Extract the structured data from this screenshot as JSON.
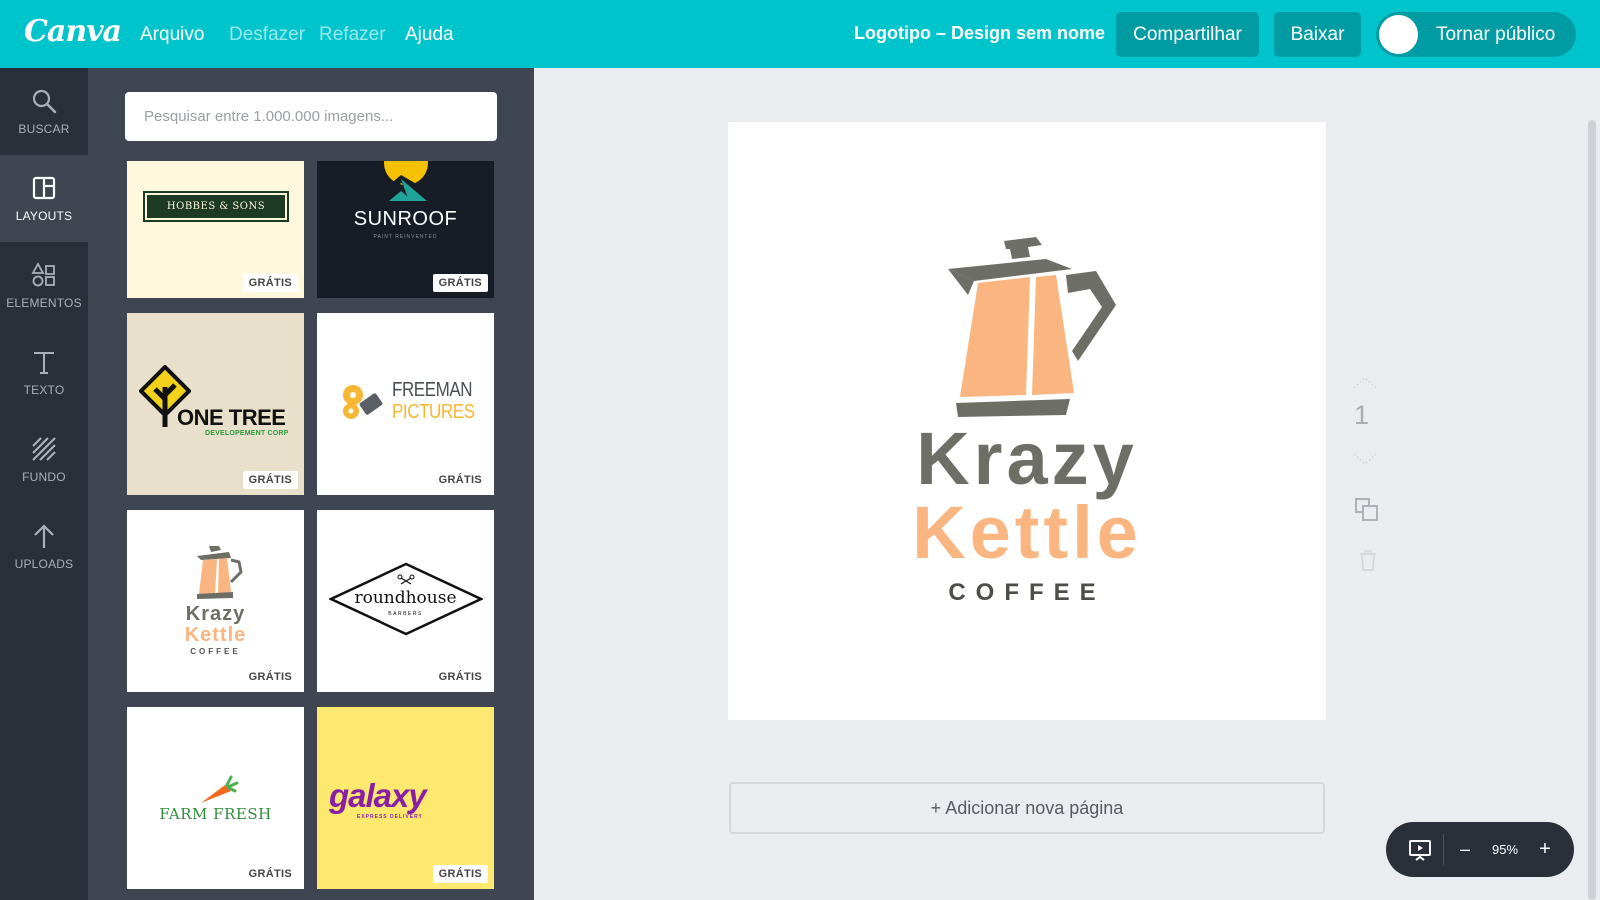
{
  "app": {
    "logo": "Canva"
  },
  "menu": {
    "file": "Arquivo",
    "undo": "Desfazer",
    "redo": "Refazer",
    "help": "Ajuda"
  },
  "header": {
    "doc_title": "Logotipo – Design sem nome",
    "share": "Compartilhar",
    "download": "Baixar",
    "public_toggle": "Tornar público"
  },
  "sidebar": {
    "items": [
      {
        "label": "BUSCAR",
        "icon": "search-icon"
      },
      {
        "label": "LAYOUTS",
        "icon": "layouts-icon",
        "active": true
      },
      {
        "label": "ELEMENTOS",
        "icon": "elements-icon"
      },
      {
        "label": "TEXTO",
        "icon": "text-icon"
      },
      {
        "label": "FUNDO",
        "icon": "background-icon"
      },
      {
        "label": "UPLOADS",
        "icon": "upload-icon"
      }
    ]
  },
  "panel": {
    "search_placeholder": "Pesquisar entre 1.000.000 imagens...",
    "templates": [
      {
        "name": "HOBBES & SONS",
        "badge": "GRÁTIS"
      },
      {
        "name": "SUNROOF",
        "sub": "PAINT REINVENTED",
        "badge": "GRÁTIS"
      },
      {
        "name": "ONE TREE",
        "sub": "DEVELOPEMENT CORP",
        "badge": "GRÁTIS"
      },
      {
        "name1": "FREEMAN",
        "name2": "PICTURES",
        "badge": "GRÁTIS"
      },
      {
        "name1": "Krazy",
        "name2": "Kettle",
        "sub": "COFFEE",
        "badge": "GRÁTIS"
      },
      {
        "name": "roundhouse",
        "sub": "BARBERS",
        "badge": "GRÁTIS"
      },
      {
        "name": "FARM FRESH",
        "badge": "GRÁTIS"
      },
      {
        "name": "galaxy",
        "sub": "EXPRESS DELIVERY",
        "badge": "GRÁTIS"
      }
    ]
  },
  "canvas": {
    "logo_line1": "Krazy",
    "logo_line2": "Kettle",
    "logo_line3": "COFFEE",
    "page_number": "1",
    "add_page": "+ Adicionar nova página",
    "zoom": "95%",
    "zoom_minus": "–",
    "zoom_plus": "+"
  },
  "colors": {
    "brand": "#00c4cc",
    "button": "#019ca3",
    "rail": "#293039",
    "panel": "#3f4652",
    "kettle_grey": "#6d6e65",
    "kettle_peach": "#fbb580"
  }
}
